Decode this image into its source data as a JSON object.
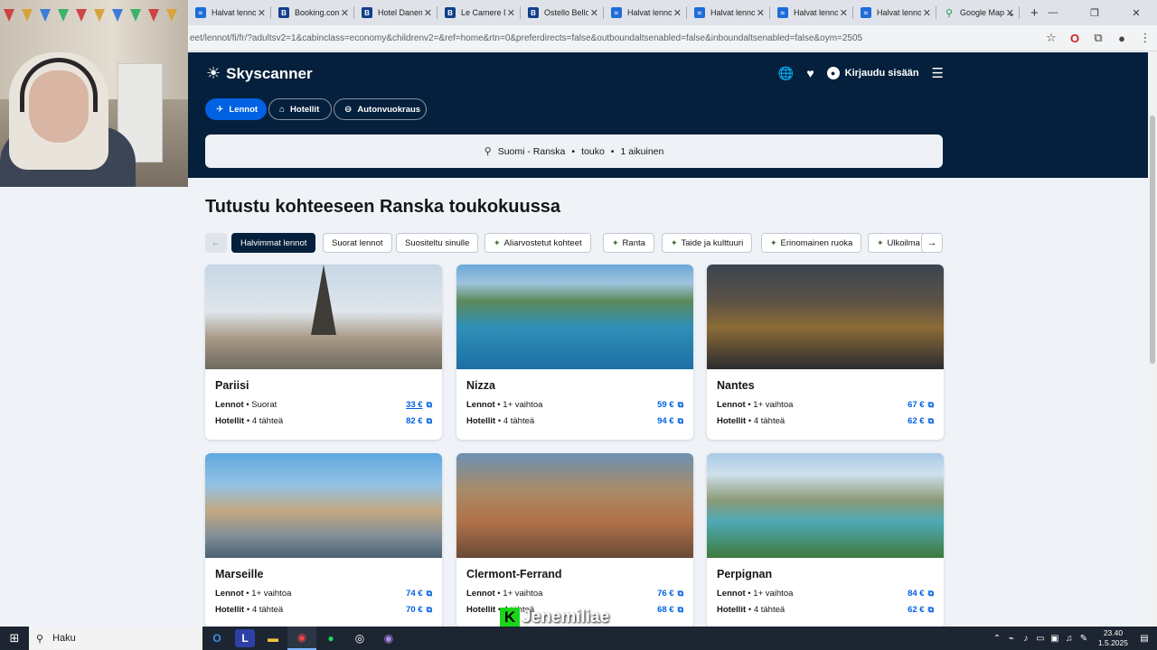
{
  "browser": {
    "tabs": [
      {
        "title": "Halvat lennot",
        "favicon": "skyscanner-icon"
      },
      {
        "title": "Booking.com",
        "favicon": "booking-icon"
      },
      {
        "title": "Hotel Danemark",
        "favicon": "booking-icon"
      },
      {
        "title": "Le Camere D",
        "favicon": "booking-icon"
      },
      {
        "title": "Ostello Bello",
        "favicon": "booking-icon"
      },
      {
        "title": "Halvat lennot",
        "favicon": "skyscanner-icon"
      },
      {
        "title": "Halvat lennot",
        "favicon": "skyscanner-icon"
      },
      {
        "title": "Halvat lennot",
        "favicon": "skyscanner-icon"
      },
      {
        "title": "Halvat lennot",
        "favicon": "skyscanner-icon"
      },
      {
        "title": "Google Maps",
        "favicon": "google-maps-icon"
      }
    ],
    "url": "eet/lennot/fi/fr/?adultsv2=1&cabinclass=economy&childrenv2=&ref=home&rtn=0&preferdirects=false&outboundaltsenabled=false&inboundaltsenabled=false&oym=2505"
  },
  "header": {
    "logo": "Skyscanner",
    "login": "Kirjaudu sisään",
    "nav": {
      "flights": "Lennot",
      "hotels": "Hotellit",
      "cars": "Autonvuokraus"
    },
    "search": {
      "origin": "Suomi - Ranska",
      "month": "touko",
      "travellers": "1 aikuinen",
      "sep": "•"
    }
  },
  "main": {
    "title": "Tutustu kohteeseen Ranska toukokuussa",
    "filters": [
      {
        "label": "Halvimmat lennot",
        "active": true,
        "icon": false
      },
      {
        "label": "Suorat lennot",
        "active": false,
        "icon": false
      },
      {
        "label": "Suositeltu sinulle",
        "active": false,
        "icon": false
      },
      {
        "label": "Aliarvostetut kohteet",
        "active": false,
        "icon": true
      },
      {
        "label": "Ranta",
        "active": false,
        "icon": true
      },
      {
        "label": "Taide ja kulttuuri",
        "active": false,
        "icon": true
      },
      {
        "label": "Erinomainen ruoka",
        "active": false,
        "icon": true
      },
      {
        "label": "Ulkoilma",
        "active": false,
        "icon": true
      }
    ],
    "cards": [
      {
        "name": "Pariisi",
        "flights_label": "Lennot",
        "flights_detail": "Suorat",
        "flights_price": "33 €",
        "hotels_label": "Hotellit",
        "hotels_detail": "4 tähteä",
        "hotels_price": "82 €"
      },
      {
        "name": "Nizza",
        "flights_label": "Lennot",
        "flights_detail": "1+ vaihtoa",
        "flights_price": "59 €",
        "hotels_label": "Hotellit",
        "hotels_detail": "4 tähteä",
        "hotels_price": "94 €"
      },
      {
        "name": "Nantes",
        "flights_label": "Lennot",
        "flights_detail": "1+ vaihtoa",
        "flights_price": "67 €",
        "hotels_label": "Hotellit",
        "hotels_detail": "4 tähteä",
        "hotels_price": "62 €"
      },
      {
        "name": "Marseille",
        "flights_label": "Lennot",
        "flights_detail": "1+ vaihtoa",
        "flights_price": "74 €",
        "hotels_label": "Hotellit",
        "hotels_detail": "4 tähteä",
        "hotels_price": "70 €"
      },
      {
        "name": "Clermont-Ferrand",
        "flights_label": "Lennot",
        "flights_detail": "1+ vaihtoa",
        "flights_price": "76 €",
        "hotels_label": "Hotellit",
        "hotels_detail": "4 tähteä",
        "hotels_price": "68 €"
      },
      {
        "name": "Perpignan",
        "flights_label": "Lennot",
        "flights_detail": "1+ vaihtoa",
        "flights_price": "84 €",
        "hotels_label": "Hotellit",
        "hotels_detail": "4 tähteä",
        "hotels_price": "62 €"
      }
    ]
  },
  "watermark": {
    "letter": "K",
    "text": "Jenemiliae"
  },
  "taskbar": {
    "search": "Haku",
    "time": "23.40",
    "date": "1.5.2025"
  },
  "colors": {
    "brand_dark": "#05203c",
    "brand_blue": "#0062e3",
    "page_bg": "#eff3f8"
  }
}
